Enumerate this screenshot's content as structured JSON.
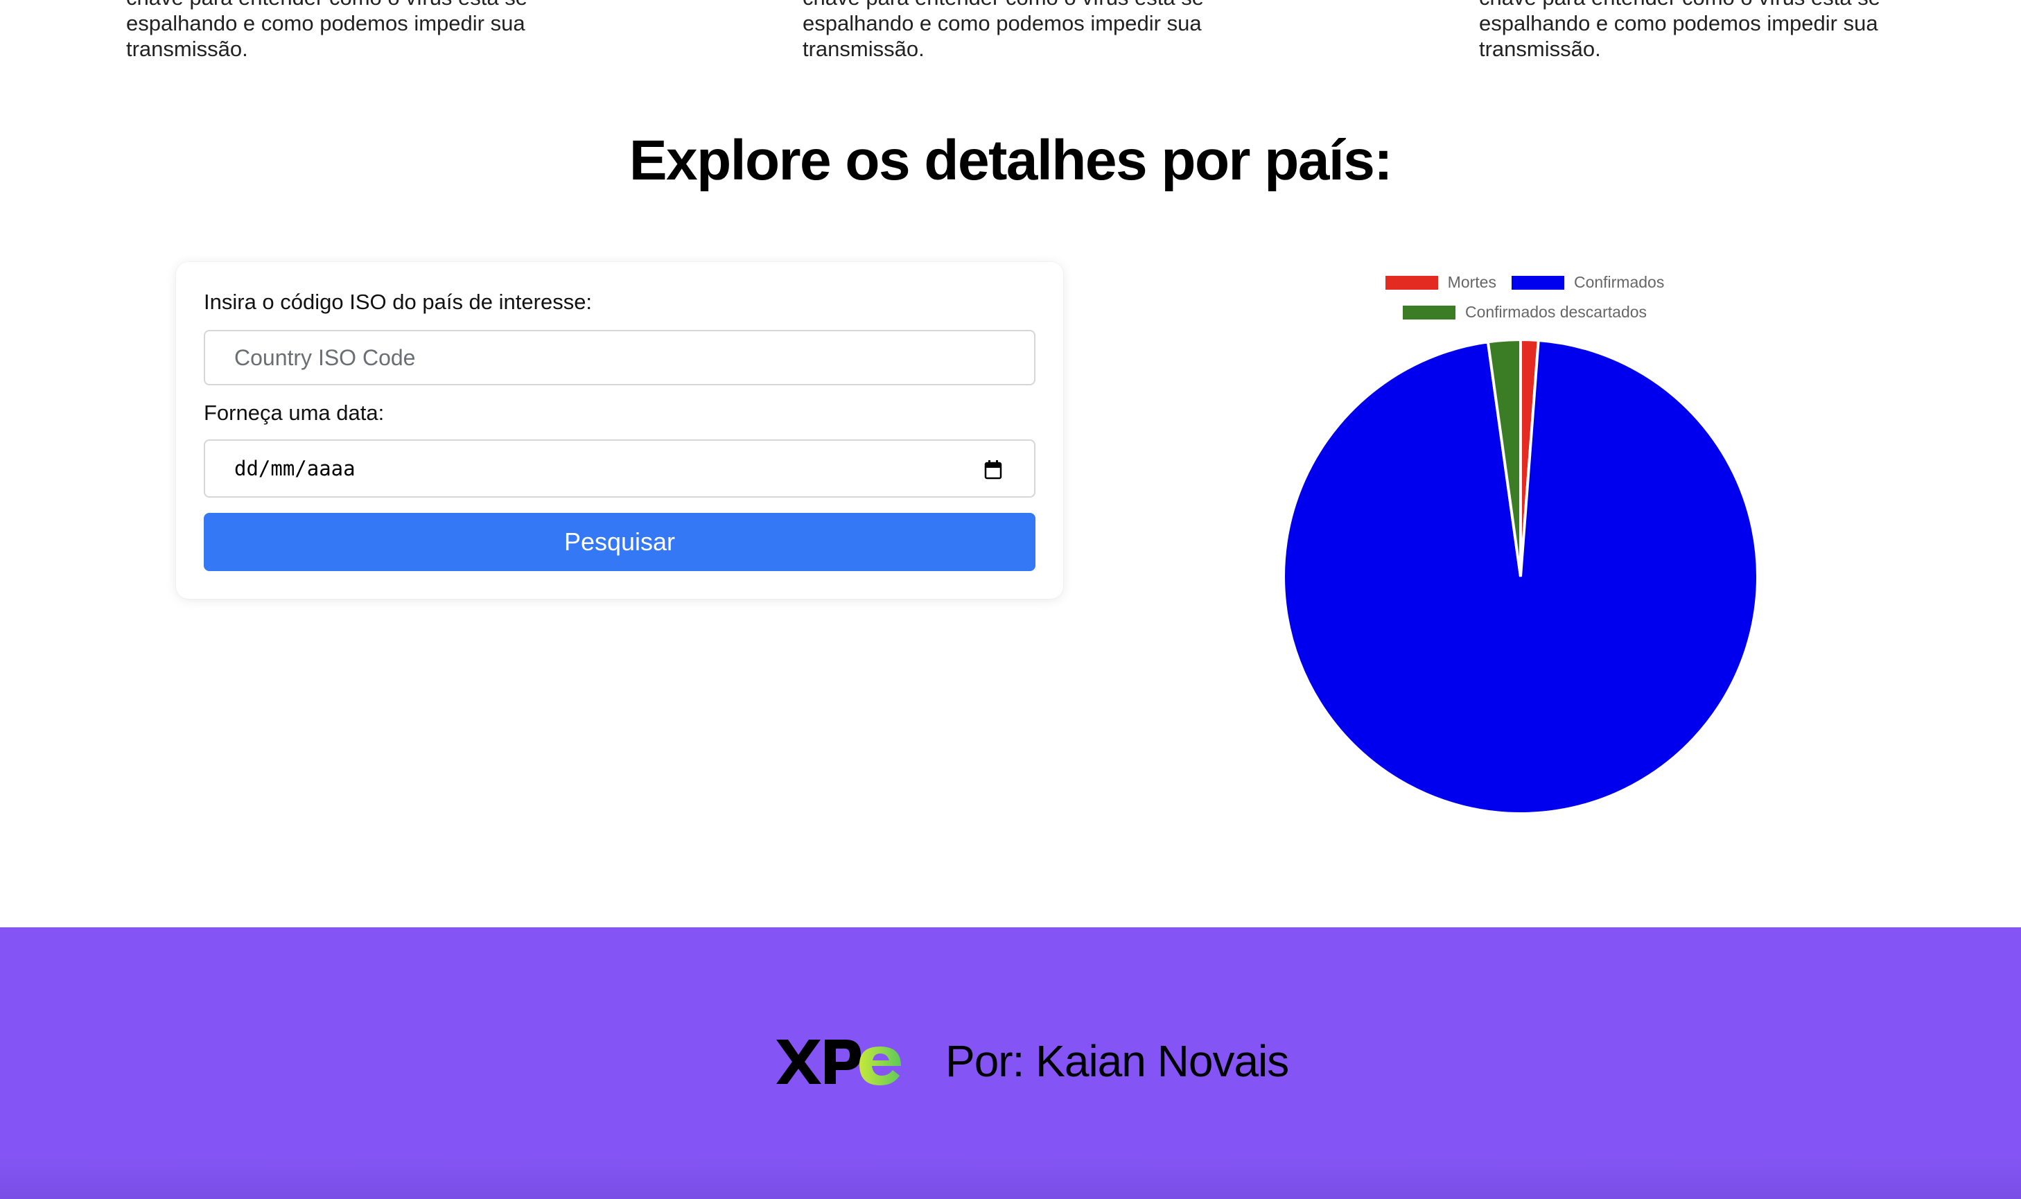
{
  "intro_columns": [
    {
      "lines": [
        "chave para entender como o vírus está se",
        "espalhando e como podemos impedir sua",
        "transmissão."
      ]
    },
    {
      "lines": [
        "chave para entender como o vírus está se",
        "espalhando e como podemos impedir sua",
        "transmissão."
      ]
    },
    {
      "lines": [
        "chave para entender como o vírus está se",
        "espalhando e como podemos impedir sua",
        "transmissão."
      ]
    }
  ],
  "section_title": "Explore os detalhes por país:",
  "form": {
    "iso_label": "Insira o código ISO do país de interesse:",
    "iso_placeholder": "Country ISO Code",
    "date_label": "Forneça uma data:",
    "date_placeholder": "dd/mm/aaaa",
    "submit_label": "Pesquisar",
    "icons": {
      "calendar": "calendar-icon"
    }
  },
  "chart_data": {
    "type": "pie",
    "categories": [
      "Mortes",
      "Confirmados",
      "Confirmados descartados"
    ],
    "values": [
      1.2,
      96.6,
      2.2
    ],
    "colors": [
      "#e32b22",
      "#0000ee",
      "#3a7d24"
    ],
    "legend_position": "top"
  },
  "footer": {
    "logo_text": "XPe",
    "author": "Por: Kaian Novais",
    "colors": {
      "background": "#8455f4",
      "logo_dark": "#000000",
      "logo_green": "#8fd14f"
    }
  }
}
